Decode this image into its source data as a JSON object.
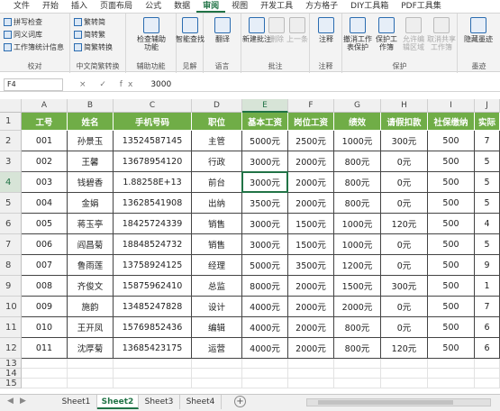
{
  "menu": {
    "tabs": [
      "文件",
      "开始",
      "插入",
      "页面布局",
      "公式",
      "数据",
      "审阅",
      "视图",
      "开发工具",
      "方方格子",
      "DIY工具箱",
      "PDF工具集"
    ],
    "active": 6
  },
  "ribbon": {
    "proof": {
      "items": [
        "拼写检查",
        "同义词库",
        "工作簿统计信息"
      ],
      "label": "校对"
    },
    "chinese": {
      "items": [
        "繁转简",
        "简转繁",
        "简繁转换"
      ],
      "label": "中文简繁转换"
    },
    "access": {
      "btn": "检查辅助功能",
      "label": "辅助功能"
    },
    "insights": {
      "btn": "智能查找",
      "label": "见解"
    },
    "lang": {
      "btn": "翻译",
      "label": "语言"
    },
    "comments": {
      "new": "新建批注",
      "del": "删除",
      "prev": "上一条",
      "next": "下一条",
      "label": "批注"
    },
    "notes": {
      "btn": "注释",
      "label": "注释"
    },
    "protect": {
      "unprotect": "撤消工作表保护",
      "wb": "保护工作簿",
      "range": "允许编辑区域",
      "share": "取消共享工作簿",
      "label": "保护"
    },
    "ink": {
      "btn": "隐藏墨迹",
      "label": "墨迹"
    }
  },
  "formula_bar": {
    "name_box": "F4",
    "fx": "× ✓ fx",
    "value": "3000"
  },
  "columns": [
    "A",
    "B",
    "C",
    "D",
    "E",
    "F",
    "G",
    "H",
    "I",
    "J"
  ],
  "selected_col": "E",
  "rows": [
    "1",
    "2",
    "3",
    "4",
    "5",
    "6",
    "7",
    "8",
    "9",
    "10",
    "11",
    "12",
    "13",
    "14",
    "15"
  ],
  "selected_row": "4",
  "table": {
    "headers": [
      "工号",
      "姓名",
      "手机号码",
      "职位",
      "基本工资",
      "岗位工资",
      "绩效",
      "请假扣款",
      "社保缴纳",
      "实际"
    ],
    "data": [
      [
        "001",
        "孙景玉",
        "13524587145",
        "主管",
        "5000元",
        "2500元",
        "1000元",
        "300元",
        "500",
        "7"
      ],
      [
        "002",
        "王馨",
        "13678954120",
        "行政",
        "3000元",
        "2000元",
        "800元",
        "0元",
        "500",
        "5"
      ],
      [
        "003",
        "钱碧香",
        "1.88258E+13",
        "前台",
        "3000元",
        "2000元",
        "800元",
        "0元",
        "500",
        "5"
      ],
      [
        "004",
        "金娟",
        "13628541908",
        "出纳",
        "3500元",
        "2000元",
        "800元",
        "0元",
        "500",
        "5"
      ],
      [
        "005",
        "蒋玉亭",
        "18425724339",
        "销售",
        "3000元",
        "1500元",
        "1000元",
        "120元",
        "500",
        "4"
      ],
      [
        "006",
        "阎昌菊",
        "18848524732",
        "销售",
        "3000元",
        "1500元",
        "1000元",
        "0元",
        "500",
        "5"
      ],
      [
        "007",
        "鲁雨莲",
        "13758924125",
        "经理",
        "5000元",
        "3500元",
        "1200元",
        "0元",
        "500",
        "9"
      ],
      [
        "008",
        "齐俊文",
        "15875962410",
        "总监",
        "8000元",
        "2000元",
        "1500元",
        "300元",
        "500",
        "1"
      ],
      [
        "009",
        "施韵",
        "13485247828",
        "设计",
        "4000元",
        "2000元",
        "2000元",
        "0元",
        "500",
        "7"
      ],
      [
        "010",
        "王开凤",
        "15769852436",
        "编辑",
        "4000元",
        "2000元",
        "800元",
        "0元",
        "500",
        "6"
      ],
      [
        "011",
        "沈厚菊",
        "13685423175",
        "运营",
        "4000元",
        "2000元",
        "800元",
        "120元",
        "500",
        "6"
      ]
    ]
  },
  "sheets": [
    "Sheet1",
    "Sheet2",
    "Sheet3",
    "Sheet4"
  ],
  "active_sheet": 1,
  "colors": {
    "accent": "#217346",
    "header_fill": "#70ad47"
  }
}
